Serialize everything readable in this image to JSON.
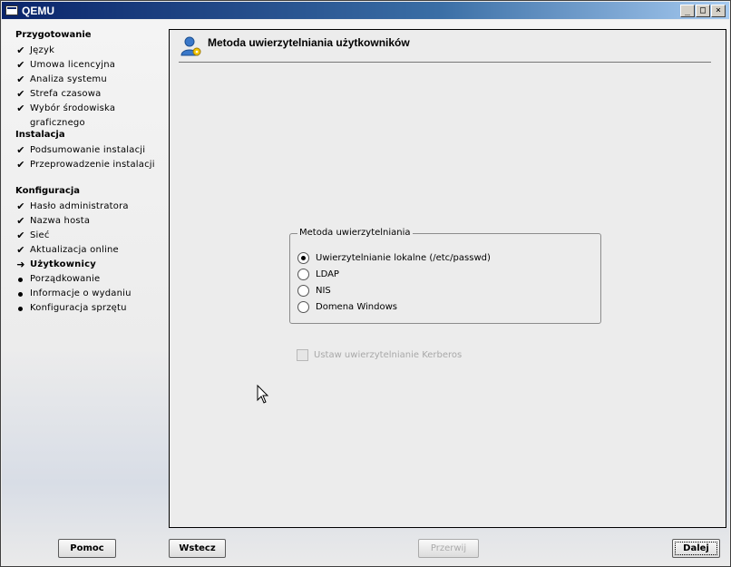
{
  "window": {
    "title": "QEMU",
    "minimize": "_",
    "maximize": "□",
    "close": "×"
  },
  "sidebar": {
    "groups": [
      {
        "title": "Przygotowanie",
        "steps": [
          {
            "label": "Język",
            "state": "done"
          },
          {
            "label": "Umowa licencyjna",
            "state": "done"
          },
          {
            "label": "Analiza systemu",
            "state": "done"
          },
          {
            "label": "Strefa czasowa",
            "state": "done"
          },
          {
            "label": "Wybór środowiska graficznego",
            "state": "done"
          }
        ]
      },
      {
        "title": "Instalacja",
        "steps": [
          {
            "label": "Podsumowanie instalacji",
            "state": "done"
          },
          {
            "label": "Przeprowadzenie instalacji",
            "state": "done"
          }
        ]
      },
      {
        "title": "Konfiguracja",
        "steps": [
          {
            "label": "Hasło administratora",
            "state": "done"
          },
          {
            "label": "Nazwa hosta",
            "state": "done"
          },
          {
            "label": "Sieć",
            "state": "done"
          },
          {
            "label": "Aktualizacja online",
            "state": "done"
          },
          {
            "label": "Użytkownicy",
            "state": "current"
          },
          {
            "label": "Porządkowanie",
            "state": "todo"
          },
          {
            "label": "Informacje o wydaniu",
            "state": "todo"
          },
          {
            "label": "Konfiguracja sprzętu",
            "state": "todo"
          }
        ]
      }
    ],
    "icons": {
      "done": "checkmark-icon",
      "current": "arrow-right-icon",
      "todo": "bullet-icon"
    }
  },
  "main": {
    "title": "Metoda uwierzytelniania użytkowników",
    "icon": "user-config-icon",
    "auth_group": {
      "legend": "Metoda uwierzytelniania",
      "options": [
        {
          "label": "Uwierzytelnianie lokalne (/etc/passwd)",
          "selected": true
        },
        {
          "label": "LDAP",
          "selected": false
        },
        {
          "label": "NIS",
          "selected": false
        },
        {
          "label": "Domena Windows",
          "selected": false
        }
      ]
    },
    "kerberos": {
      "label": "Ustaw uwierzytelnianie Kerberos",
      "checked": false,
      "enabled": false
    }
  },
  "buttons": {
    "help": "Pomoc",
    "back": "Wstecz",
    "abort": "Przerwij",
    "next": "Dalej"
  },
  "colors": {
    "titlebar_start": "#0a246a",
    "titlebar_end": "#a6caf0"
  }
}
